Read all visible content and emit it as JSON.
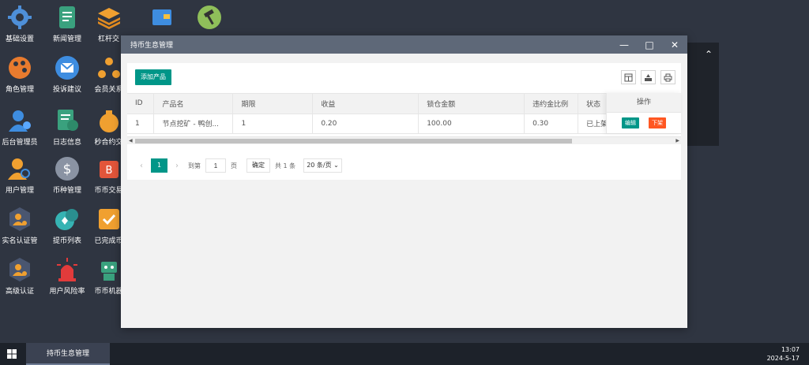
{
  "desktop": {
    "icons": [
      {
        "label": "基础设置",
        "icon": "gear-icon"
      },
      {
        "label": "新闻管理",
        "icon": "document-icon"
      },
      {
        "label": "杠杆交",
        "icon": "layers-icon"
      },
      {
        "label": "",
        "icon": "card-icon"
      },
      {
        "label": "",
        "icon": "hammer-icon"
      },
      {
        "label": "角色管理",
        "icon": "palette-icon"
      },
      {
        "label": "投诉建议",
        "icon": "mail-icon"
      },
      {
        "label": "会员关系",
        "icon": "network-icon"
      },
      {
        "label": "后台管理员",
        "icon": "admin-user-icon"
      },
      {
        "label": "日志信息",
        "icon": "clock-doc-icon"
      },
      {
        "label": "秒合约交",
        "icon": "money-bag-icon"
      },
      {
        "label": "用户管理",
        "icon": "user-search-icon"
      },
      {
        "label": "币种管理",
        "icon": "dollar-icon"
      },
      {
        "label": "币币交易",
        "icon": "bitcoin-icon"
      },
      {
        "label": "实名认证管",
        "icon": "verify-user-icon"
      },
      {
        "label": "提币列表",
        "icon": "coin-list-icon"
      },
      {
        "label": "已完成币",
        "icon": "check-icon"
      },
      {
        "label": "高级认证",
        "icon": "advanced-verify-icon"
      },
      {
        "label": "用户风险率",
        "icon": "alarm-icon"
      },
      {
        "label": "币币机器",
        "icon": "robot-icon"
      }
    ]
  },
  "window": {
    "title": "持币生息管理",
    "minimize": "—",
    "maximize": "□",
    "close": "✕"
  },
  "toolbar": {
    "add_label": "添加产品"
  },
  "table": {
    "headers": [
      "ID",
      "产品名",
      "期限",
      "收益",
      "锁仓金额",
      "违约金比例",
      "状态"
    ],
    "rows": [
      [
        "1",
        "节点挖矿 - 鸭创...",
        "1",
        "0.20",
        "100.00",
        "0.30",
        "已上架"
      ]
    ],
    "ops_header": "操作",
    "edit_label": "编辑",
    "off_label": "下架"
  },
  "pager": {
    "current": "1",
    "goto_label": "到第",
    "page_value": "1",
    "page_label": "页",
    "confirm_label": "确定",
    "total_label": "共 1 条",
    "per_page": "20 条/页"
  },
  "taskbar": {
    "task_label": "持币生息管理",
    "time": "13:07",
    "date": "2024-5-17"
  },
  "colors": {
    "accent": "#009688",
    "danger": "#ff5722",
    "titlebar": "#5e6878",
    "desktop": "#2f3541"
  }
}
